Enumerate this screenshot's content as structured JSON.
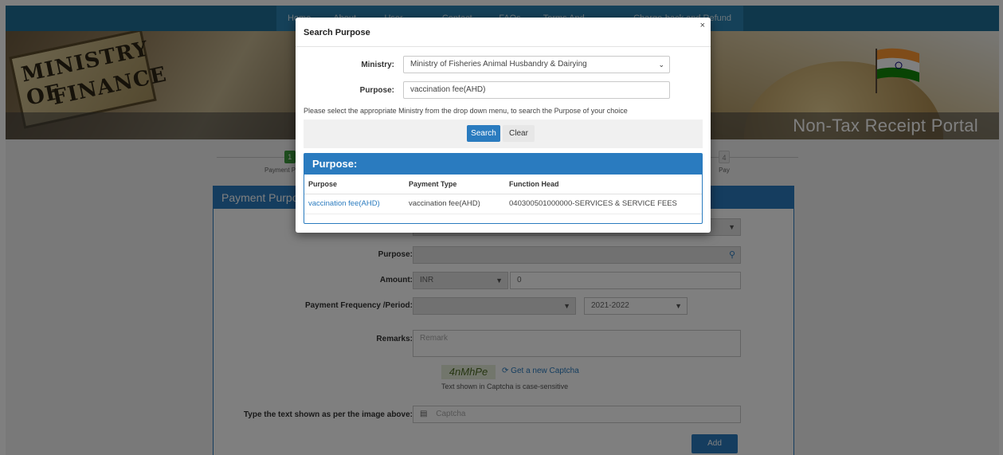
{
  "nav": {
    "items": [
      "Home",
      "About Us",
      "User Guide",
      "Contact Us",
      "FAQs",
      "Terms And Conditions",
      "Charge-back and Refund Policy"
    ]
  },
  "banner": {
    "plaque_line1": "MINISTRY OF",
    "plaque_line2": "FINANCE",
    "portal_title": "Non-Tax Receipt Portal"
  },
  "steps": [
    {
      "num": "1",
      "label": "Payment Purpose"
    },
    {
      "num": "4",
      "label": "Pay"
    }
  ],
  "form": {
    "panel_title": "Payment Purpose",
    "purpose_label": "Purpose:",
    "amount_label": "Amount:",
    "currency": "INR",
    "amount_value": "0",
    "frequency_label": "Payment Frequency /Period:",
    "year": "2021-2022",
    "remarks_label": "Remarks:",
    "remarks_placeholder": "Remark",
    "captcha_text": "4nMhPe",
    "captcha_refresh": "Get a new Captcha",
    "captcha_note": "Text shown in Captcha is case-sensitive",
    "captcha_label": "Type the text shown as per the image above:",
    "captcha_placeholder": "Captcha",
    "add_label": "Add"
  },
  "modal": {
    "title": "Search Purpose",
    "close": "×",
    "ministry_label": "Ministry:",
    "ministry_value": "Ministry of Fisheries Animal Husbandry & Dairying",
    "purpose_label": "Purpose:",
    "purpose_value": "vaccination fee(AHD)",
    "help_text": "Please select the appropriate Ministry from the drop down menu, to search the Purpose of your choice",
    "search_label": "Search",
    "clear_label": "Clear",
    "results_title": "Purpose:",
    "columns": [
      "Purpose",
      "Payment Type",
      "Function Head"
    ],
    "rows": [
      [
        "vaccination fee(AHD)",
        "vaccination fee(AHD)",
        "040300501000000-SERVICES & SERVICE FEES"
      ]
    ]
  },
  "colors": {
    "primary": "#2a7bbf",
    "nav": "#1e6e97",
    "step_active": "#3c9a3c"
  }
}
